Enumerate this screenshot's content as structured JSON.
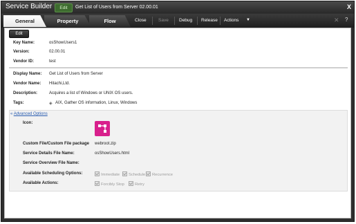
{
  "window": {
    "app_title": "Service Builder",
    "mode_badge": "Edit",
    "document_title": "Get List of Users from Server 02.00.01",
    "close_glyph": "X"
  },
  "tabs": [
    {
      "label": "General",
      "active": true
    },
    {
      "label": "Property",
      "active": false
    },
    {
      "label": "Flow",
      "active": false
    }
  ],
  "toolbar": {
    "close": "Close",
    "save": "Save",
    "debug": "Debug",
    "release": "Release",
    "actions": "Actions"
  },
  "content": {
    "edit_button": "Edit",
    "key_name_label": "Key Name:",
    "key_name_value": "osShowUsers1",
    "version_label": "Version:",
    "version_value": "02.00.01",
    "vendor_id_label": "Vendor ID:",
    "vendor_id_value": "test",
    "display_name_label": "Display Name:",
    "display_name_value": "Get List of Users from Server",
    "vendor_name_label": "Vendor Name:",
    "vendor_name_value": "Hitachi,Ltd.",
    "description_label": "Description:",
    "description_value": "Acquires a list of Windows or UNIX OS users.",
    "tags_label": "Tags:",
    "tags_value": "AIX, Gather OS information, Linux, Windows"
  },
  "advanced": {
    "toggle_label": "Advanced Options",
    "icon_label": "Icon:",
    "custom_file_label": "Custom File/Custom File package",
    "custom_file_value": "webroot.zip",
    "details_file_label": "Service Details File Name:",
    "details_file_value": "osShowUsers.html",
    "overview_file_label": "Service Overview File Name:",
    "overview_file_value": "",
    "scheduling_label": "Available Scheduling Options:",
    "scheduling_options": [
      "Immediate",
      "Schedule",
      "Recurrence"
    ],
    "actions_label": "Available Actions:",
    "action_options": [
      "Forcibly Stop",
      "Retry"
    ]
  },
  "colors": {
    "accent_link": "#2a5db0",
    "app_icon": "#d8208c",
    "edit_badge": "#3d6b2f"
  }
}
